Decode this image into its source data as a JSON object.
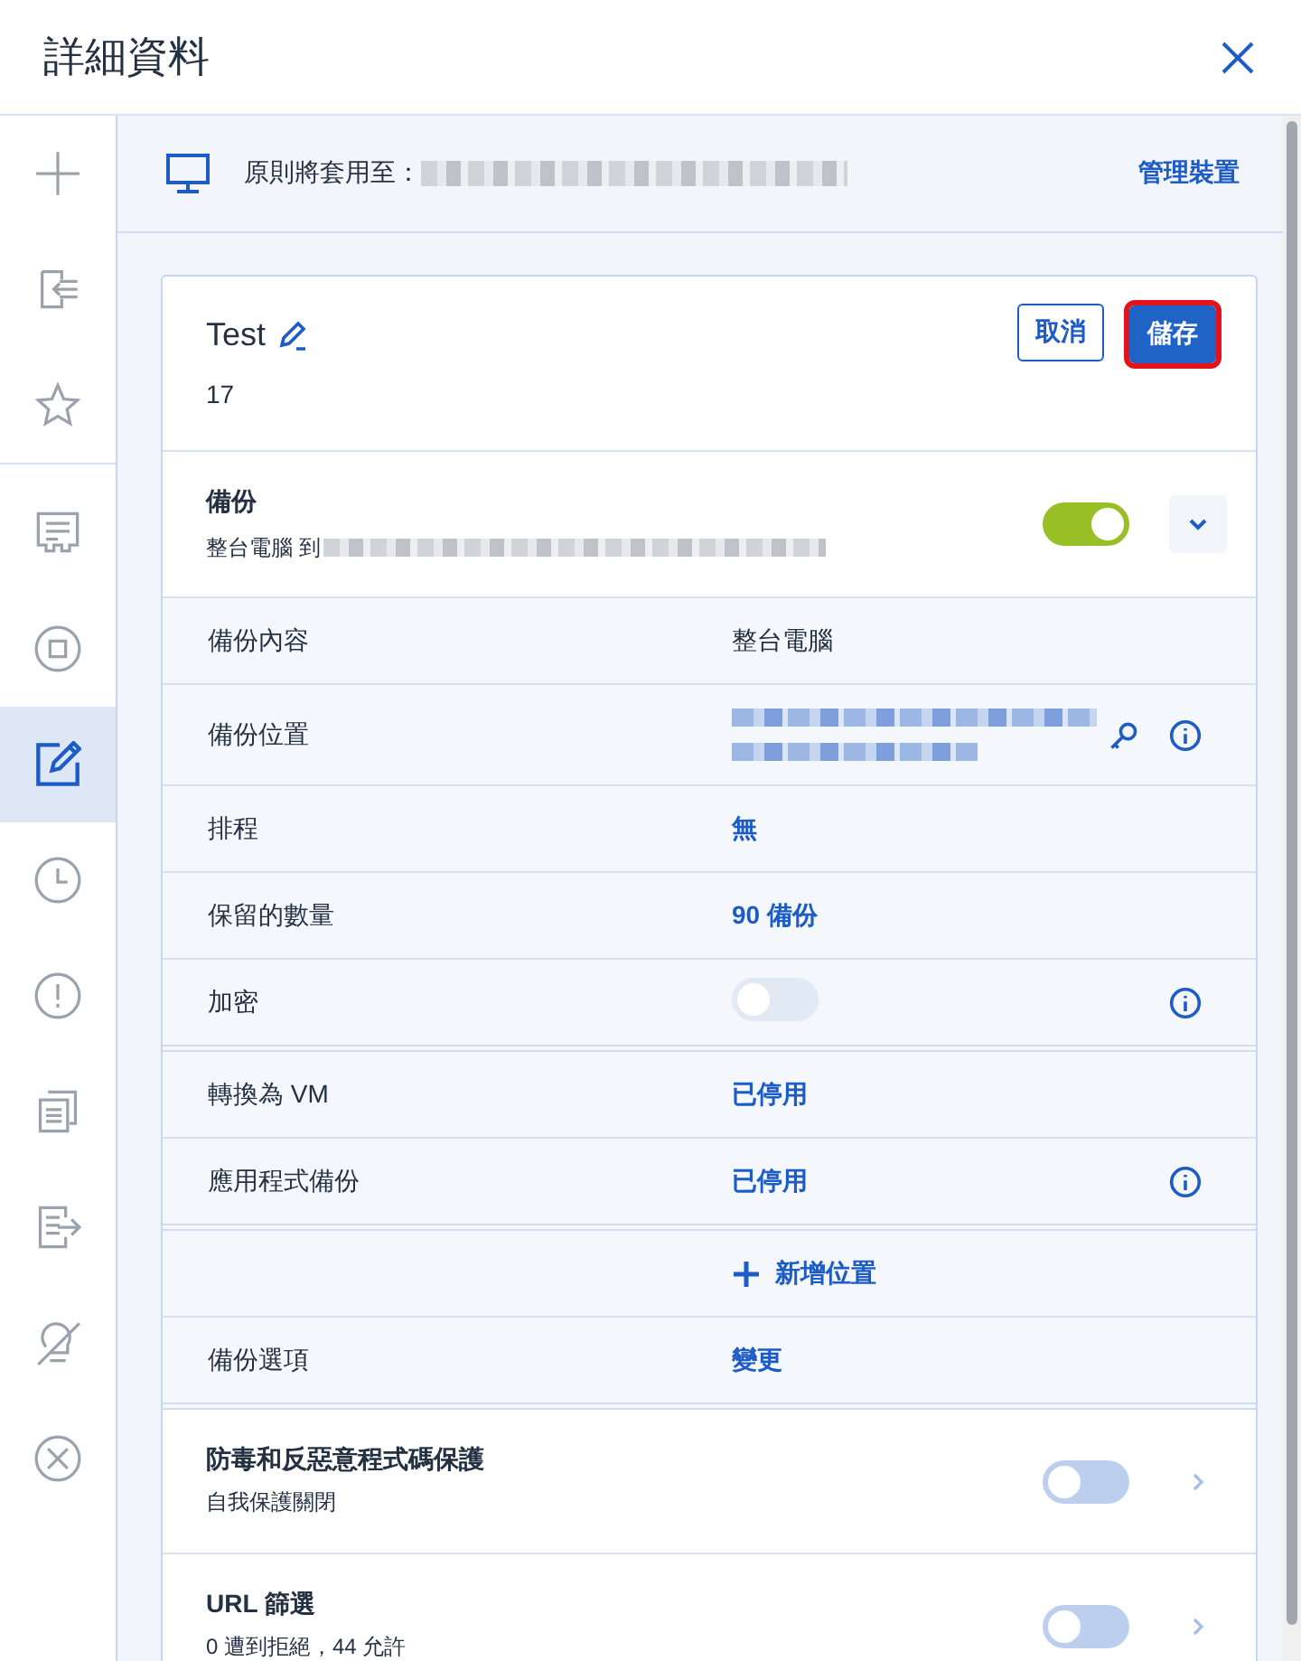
{
  "title": "詳細資料",
  "sidebar": {
    "groups": [
      [
        {
          "kind": "add",
          "selected": false
        },
        {
          "kind": "import",
          "selected": false
        },
        {
          "kind": "star",
          "selected": false
        }
      ],
      [
        {
          "kind": "receipt",
          "selected": false
        },
        {
          "kind": "stop",
          "selected": false
        },
        {
          "kind": "edit",
          "selected": true
        },
        {
          "kind": "clock",
          "selected": false
        },
        {
          "kind": "alert",
          "selected": false
        },
        {
          "kind": "copy",
          "selected": false
        },
        {
          "kind": "export",
          "selected": false
        },
        {
          "kind": "revoke",
          "selected": false
        },
        {
          "kind": "remove",
          "selected": false
        }
      ]
    ]
  },
  "applies_bar": {
    "label": "原則將套用至：",
    "link": "管理裝置"
  },
  "plan": {
    "name": "Test",
    "subtitle": "17",
    "buttons": [
      {
        "label": "取消",
        "kind": "secondary",
        "highlighted": false
      },
      {
        "label": "儲存",
        "kind": "primary",
        "highlighted": true
      }
    ]
  },
  "backup": {
    "title": "備份",
    "subtitle": "整台電腦 到",
    "on": true,
    "expanded": false
  },
  "settings": [
    [
      {
        "kind": "text",
        "label": "備份內容",
        "value": "整台電腦",
        "info": false
      },
      {
        "kind": "location",
        "label": "備份位置",
        "info": true
      },
      {
        "kind": "link",
        "label": "排程",
        "value": "無",
        "info": false
      },
      {
        "kind": "link",
        "label": "保留的數量",
        "value": "90 備份",
        "info": false
      },
      {
        "kind": "toggle",
        "label": "加密",
        "on": false,
        "disabled": true,
        "info": true
      }
    ],
    [
      {
        "kind": "link",
        "label": "轉換為 VM",
        "value": "已停用",
        "info": false
      },
      {
        "kind": "link",
        "label": "應用程式備份",
        "value": "已停用",
        "info": true
      }
    ],
    [
      {
        "kind": "add",
        "value": "新增位置",
        "info": false
      },
      {
        "kind": "link",
        "label": "備份選項",
        "value": "變更",
        "info": false
      }
    ]
  ],
  "protections": [
    {
      "title": "防毒和反惡意程式碼保護",
      "subtitle": "自我保護關閉",
      "on": false
    },
    {
      "title": "URL 篩選",
      "subtitle": "0 遭到拒絕，44 允許",
      "on": false
    }
  ]
}
